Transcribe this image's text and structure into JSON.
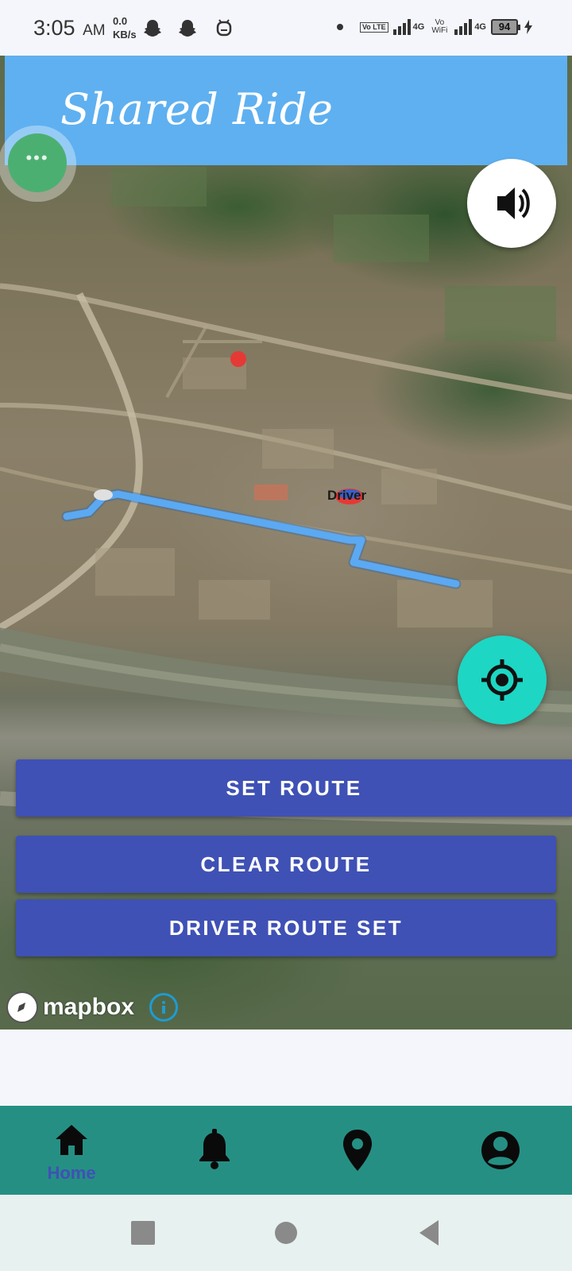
{
  "status_bar": {
    "time": "3:05",
    "ampm": "AM",
    "speed_value": "0.0",
    "speed_unit": "KB/s",
    "network_type_1": "4G",
    "network_type_2": "4G",
    "volte_label": "Vo LTE",
    "vowifi_label": "Vo WiFi",
    "battery_level": "94",
    "icons": [
      "snapchat-icon",
      "snapchat-icon",
      "notification-icon",
      "dot-icon",
      "volte-icon",
      "signal-icon",
      "vowifi-icon",
      "signal-icon",
      "battery-icon",
      "charging-icon"
    ]
  },
  "header": {
    "title": "Shared Ride",
    "color": "#5fb0f0"
  },
  "map": {
    "driver_marker_label": "Driver",
    "attribution": "mapbox",
    "route_color": "#5ba9f2",
    "pin_color": "#e53935"
  },
  "actions": {
    "set_route": "SET ROUTE",
    "clear_route": "CLEAR ROUTE",
    "driver_route_set": "DRIVER ROUTE SET",
    "button_color": "#3f51b5"
  },
  "bottom_nav": {
    "color": "#268f84",
    "items": [
      {
        "icon": "home-icon",
        "label": "Home",
        "active": true
      },
      {
        "icon": "bell-icon",
        "label": ""
      },
      {
        "icon": "location-pin-icon",
        "label": ""
      },
      {
        "icon": "profile-icon",
        "label": ""
      }
    ]
  },
  "system_nav": {
    "icons": [
      "recents-icon",
      "home-circle-icon",
      "back-icon"
    ]
  }
}
